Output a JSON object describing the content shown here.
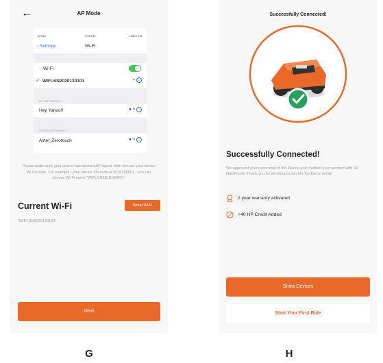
{
  "screen_g": {
    "title": "AP Mode",
    "back_icon": "arrow-left-icon",
    "ios": {
      "status_left": "ail Bell",
      "status_time": "9:00 PM",
      "status_right": "• 100% 100",
      "nav_back": "Settings",
      "nav_title": "Wi-Fi",
      "wifi_label": "Wi-Fi",
      "wifi_toggle_on": true,
      "connected_network": "WIFI-SN2020130101",
      "my_networks_header": "MY NETWORKS",
      "my_networks": [
        "Hey Yahoo!!"
      ],
      "other_networks_header": "OTHER NETWORKS",
      "other_networks": [
        "Airtel_Zerotouch"
      ],
      "info_glyph": "i"
    },
    "instructions": "Please make sure your device has opened AP signal, then choose your device Wi-Fi name. For example : your device SN code is 2018100001 , you can choose Wi-Fi name “WIFI-SN2018100001”",
    "current_wifi_label": "Current Wi-Fi",
    "setup_button": "Setup Wi-Fi",
    "current_ssid": "“WIFI-SN2020130120”",
    "next_button": "Next",
    "caption": "G"
  },
  "screen_h": {
    "top_title": "Successfully Connected!",
    "heading": "Successfully Connected!",
    "description": "We approved your ownership of the Device and credited your account with 40 HaloPoints. Thank you for deciding to join the Yardforce family!",
    "benefits": [
      {
        "icon": "award-ribbon-icon",
        "text": "2 year warranty activated"
      },
      {
        "icon": "no-ban-icon",
        "text": "+40 HP Credit Added"
      }
    ],
    "show_devices_button": "Show Devices",
    "first_ride_button": "Start Your First Ride",
    "caption": "H"
  },
  "colors": {
    "accent": "#e8692a",
    "ios_blue": "#2f74d0",
    "toggle_green": "#49c45c",
    "success_green": "#27a15c",
    "muted_text": "#9a9a9a"
  }
}
